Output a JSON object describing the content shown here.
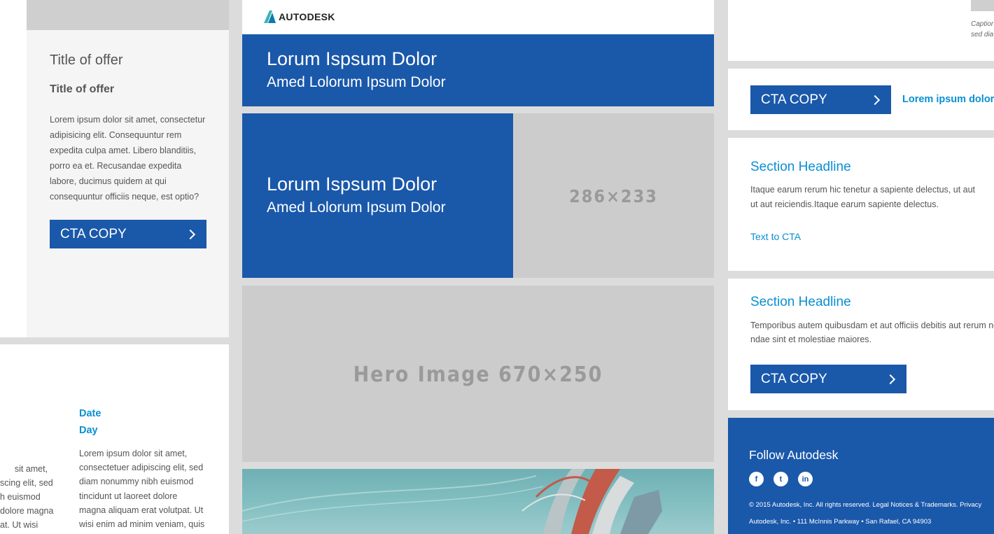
{
  "brand": {
    "logo_text": "AUTODESK"
  },
  "left_offer": {
    "title": "Title of offer",
    "subtitle": "Title of offer",
    "body": "Lorem ipsum dolor sit amet, consectetur adipisicing elit. Consequuntur rem expedita culpa amet. Libero blanditiis, porro ea et. Recusandae expedita labore, ducimus quidem at qui consequuntur officiis neque, est optio?",
    "cta_label": "CTA COPY"
  },
  "left_event": {
    "date_label": "Date",
    "day_label": "Day",
    "body": "Lorem ipsum dolor sit amet, consectetuer adipiscing elit, sed diam nonummy nibh euismod tincidunt ut laoreet dolore magna aliquam erat volutpat. Ut wisi enim ad minim veniam, quis",
    "partial_body": "sit amet,\nscing elit, sed\nh euismod\ndolore magna\nat. Ut wisi\niam, quis"
  },
  "header_banner": {
    "headline": "Lorum Ispsum Dolor",
    "subheadline": "Amed Lolorum Ipsum Dolor"
  },
  "split_banner": {
    "headline": "Lorum Ispsum Dolor",
    "subheadline": "Amed Lolorum Ipsum Dolor",
    "image_placeholder": "286×233"
  },
  "hero": {
    "placeholder": "Hero Image 670×250"
  },
  "right_column": {
    "caption_partial": "Captior\nsed dia",
    "cta_row": {
      "cta_label": "CTA COPY",
      "link_text": "Lorem ipsum dolor"
    },
    "section1": {
      "headline": "Section Headline",
      "body": "Itaque earum rerum hic tenetur a sapiente delectus, ut aut ut aut reiciendis.Itaque earum sapiente delectus.",
      "link_text": "Text to CTA"
    },
    "section2": {
      "headline": "Section Headline",
      "body": "Temporibus autem quibusdam et aut officiis debitis aut rerum necessitatibus saepe eveniet ut et voluptates repudiandae sint et molestiae maiores.",
      "body_visible_line1": "Temporibus autem quibusdam et aut officiis debitis aut rerum nec",
      "body_visible_line2": "ndae sint et molestiae maiores.",
      "cta_label": "CTA COPY"
    },
    "footer": {
      "title": "Follow Autodesk",
      "social": [
        "f",
        "t",
        "in"
      ],
      "legal": "© 2015 Autodesk, Inc. All rights reserved. Legal Notices & Trademarks. Privacy",
      "address": "Autodesk, Inc. • 111 McInnis Parkway • San Rafael, CA 94903"
    }
  },
  "colors": {
    "brand_blue": "#1a58aa",
    "link_blue": "#0a8fd3",
    "placeholder_gray": "#cccccc"
  }
}
